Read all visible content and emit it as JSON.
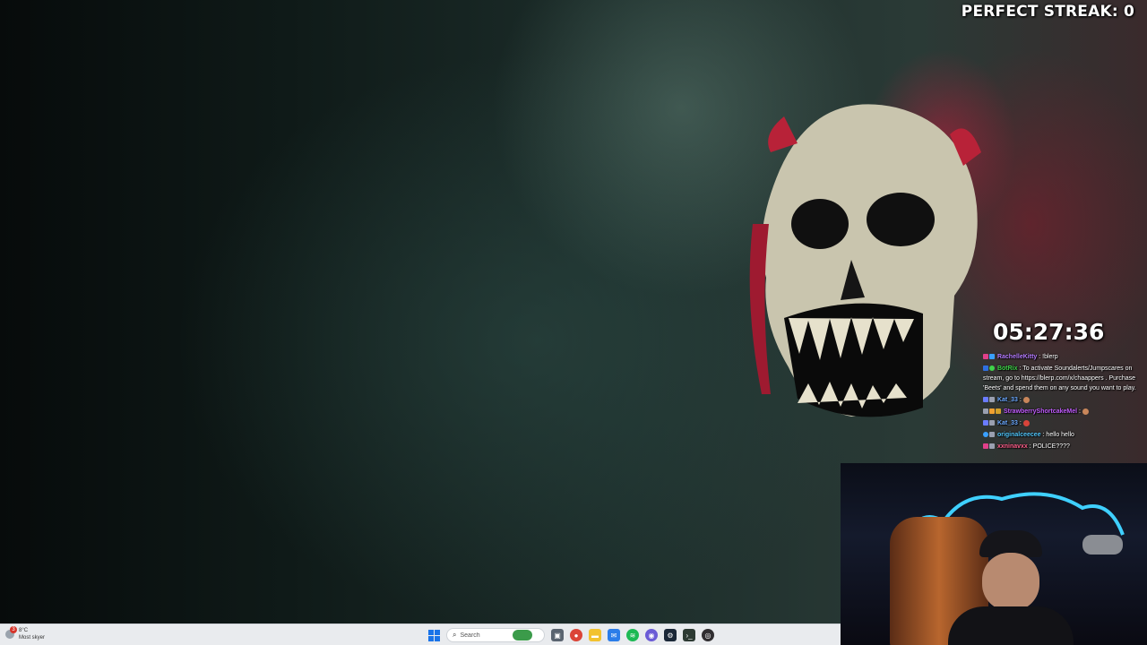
{
  "overlay": {
    "streak_text": "PERFECT STREAK: 0",
    "timer": "05:27:36"
  },
  "chat": {
    "messages": [
      {
        "user": "RachelleKitty",
        "user_color": "#b57cff",
        "text": " : !blerp"
      },
      {
        "user": "BotRix",
        "user_color": "#3fd34a",
        "text": " : To activate Soundalerts/Jumpscares on stream, go to https://blerp.com/x/chaappers . Purchase 'Beets' and spend them on any sound you want to play."
      },
      {
        "user": "Kat_33",
        "user_color": "#6aa8ff",
        "text": " : "
      },
      {
        "user": "StrawberryShortcakeMel",
        "user_color": "#c25cff",
        "text": " : "
      },
      {
        "user": "Kat_33",
        "user_color": "#6aa8ff",
        "text": " : "
      },
      {
        "user": "originalceecee",
        "user_color": "#4fc3f7",
        "text": " : hello hello"
      },
      {
        "user": "xxninavxx",
        "user_color": "#ff5e8a",
        "text": " : POLICE????"
      }
    ]
  },
  "taskbar": {
    "weather": {
      "temp": "8°C",
      "condition": "Most skyer",
      "alert_count": "3"
    },
    "search": {
      "placeholder": "Search"
    },
    "apps": [
      {
        "name": "file-view",
        "color": "#5a6470"
      },
      {
        "name": "chrome",
        "color": "#db4437"
      },
      {
        "name": "file-explorer",
        "color": "#f2c230"
      },
      {
        "name": "mail",
        "color": "#2b7de9"
      },
      {
        "name": "spotify",
        "color": "#1db954"
      },
      {
        "name": "discord-like",
        "color": "#6b5bd6"
      },
      {
        "name": "steam",
        "color": "#1b2838"
      },
      {
        "name": "terminal",
        "color": "#2d3a33"
      },
      {
        "name": "obs",
        "color": "#302e31"
      }
    ]
  },
  "colors": {
    "taskbar_bg": "#e9ebee",
    "overlay_text": "#ffffff",
    "blood_red": "#c8203c"
  }
}
